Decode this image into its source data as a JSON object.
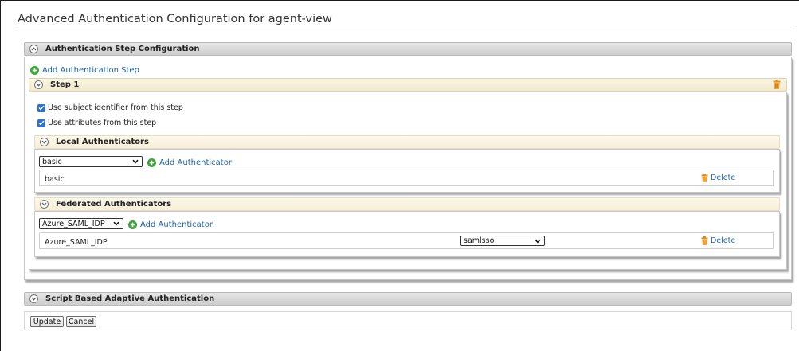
{
  "page": {
    "title": "Advanced Authentication Configuration for agent-view"
  },
  "auth_step_config": {
    "title": "Authentication Step Configuration",
    "add_step_label": "Add Authentication Step"
  },
  "step": {
    "title": "Step 1",
    "checkboxes": [
      {
        "label": "Use subject identifier from this step",
        "checked": true
      },
      {
        "label": "Use attributes from this step",
        "checked": true
      }
    ]
  },
  "local": {
    "title": "Local Authenticators",
    "selected": "basic",
    "add_label": "Add Authenticator",
    "rows": [
      {
        "name": "basic",
        "delete_label": "Delete"
      }
    ]
  },
  "federated": {
    "title": "Federated Authenticators",
    "selected": "Azure_SAML_IDP",
    "add_label": "Add Authenticator",
    "rows": [
      {
        "name": "Azure_SAML_IDP",
        "option_selected": "samlsso",
        "delete_label": "Delete"
      }
    ]
  },
  "script": {
    "title": "Script Based Adaptive Authentication"
  },
  "actions": {
    "update_label": "Update",
    "cancel_label": "Cancel"
  },
  "colors": {
    "link": "#2162a8",
    "plus": "#3da53a",
    "trash": "#e8901a",
    "checkbox": "#2d6fd6"
  },
  "icons": [
    "plus-circle-icon",
    "trash-icon",
    "chevron-down-icon",
    "chevron-up-icon",
    "checkbox-icon"
  ]
}
